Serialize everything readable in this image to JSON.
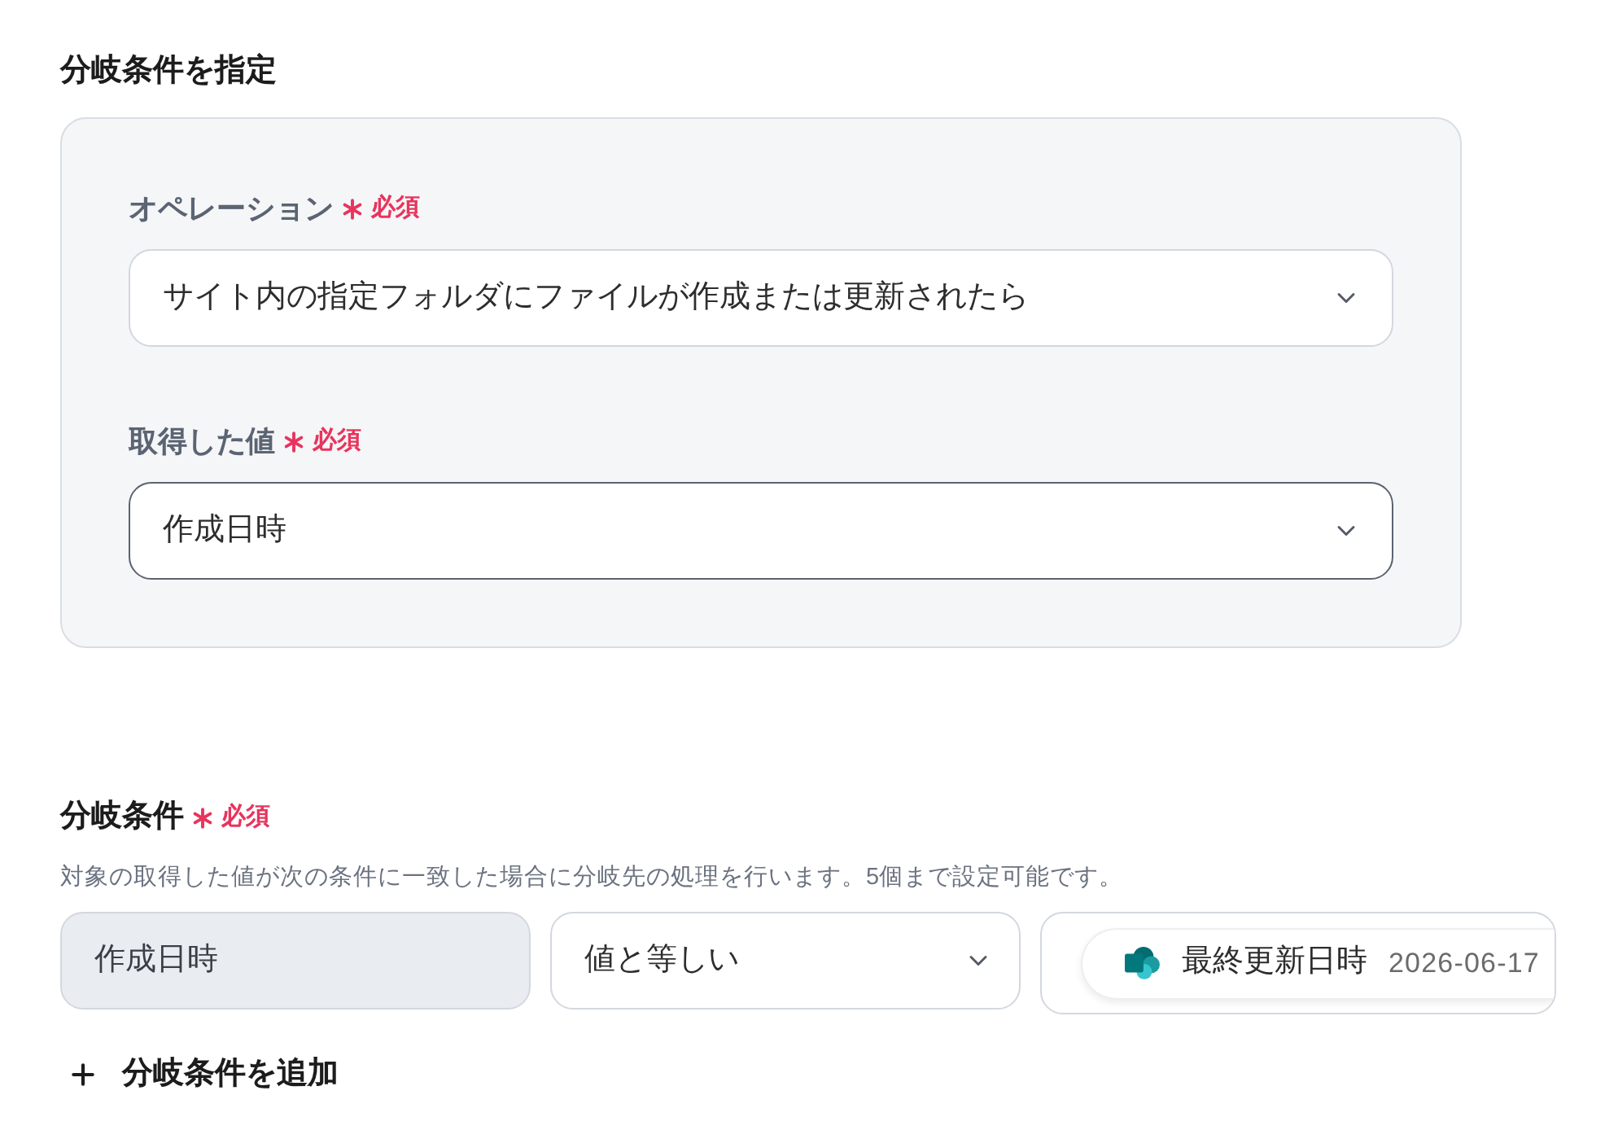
{
  "section": {
    "title": "分岐条件を指定"
  },
  "panel": {
    "fields": [
      {
        "label": "オペレーション",
        "required": true,
        "required_label": "必須",
        "value": "サイト内の指定フォルダにファイルが作成または更新されたら",
        "focused": false
      },
      {
        "label": "取得した値",
        "required": true,
        "required_label": "必須",
        "value": "作成日時",
        "focused": true
      }
    ]
  },
  "conditions": {
    "label": "分岐条件",
    "required": true,
    "required_label": "必須",
    "description": "対象の取得した値が次の条件に一致した場合に分岐先の処理を行います。5個まで設定可能です。",
    "rows": [
      {
        "target": {
          "value": "作成日時",
          "disabled": true
        },
        "operator": {
          "value": "値と等しい"
        },
        "value_chip": {
          "name": "最終更新日時",
          "value": "2026-06-17"
        }
      }
    ]
  },
  "add_button": {
    "label": "分岐条件を追加"
  }
}
